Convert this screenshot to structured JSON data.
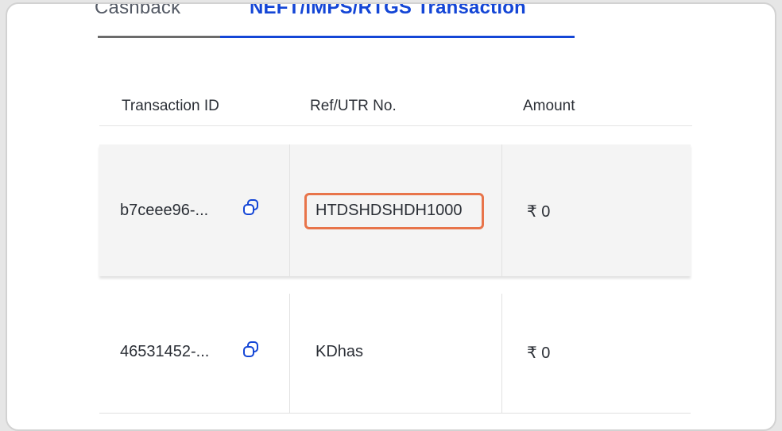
{
  "tabs": [
    {
      "label": "Cashback"
    },
    {
      "label": "NEFT/IMPS/RTGS Transaction"
    }
  ],
  "table": {
    "columns": [
      "Transaction ID",
      "Ref/UTR No.",
      "Amount"
    ],
    "rows": [
      {
        "transaction_id": "b7ceee96-...",
        "ref_utr": "HTDSHDSHDH1000",
        "amount": "₹ 0"
      },
      {
        "transaction_id": "46531452-...",
        "ref_utr": "KDhas",
        "amount": "₹ 0"
      }
    ]
  },
  "icons": {
    "copy": "copy-icon"
  },
  "colors": {
    "active_tab": "#1446d6",
    "highlight": "#e8744a",
    "row_highlight_bg": "#f4f4f4"
  }
}
